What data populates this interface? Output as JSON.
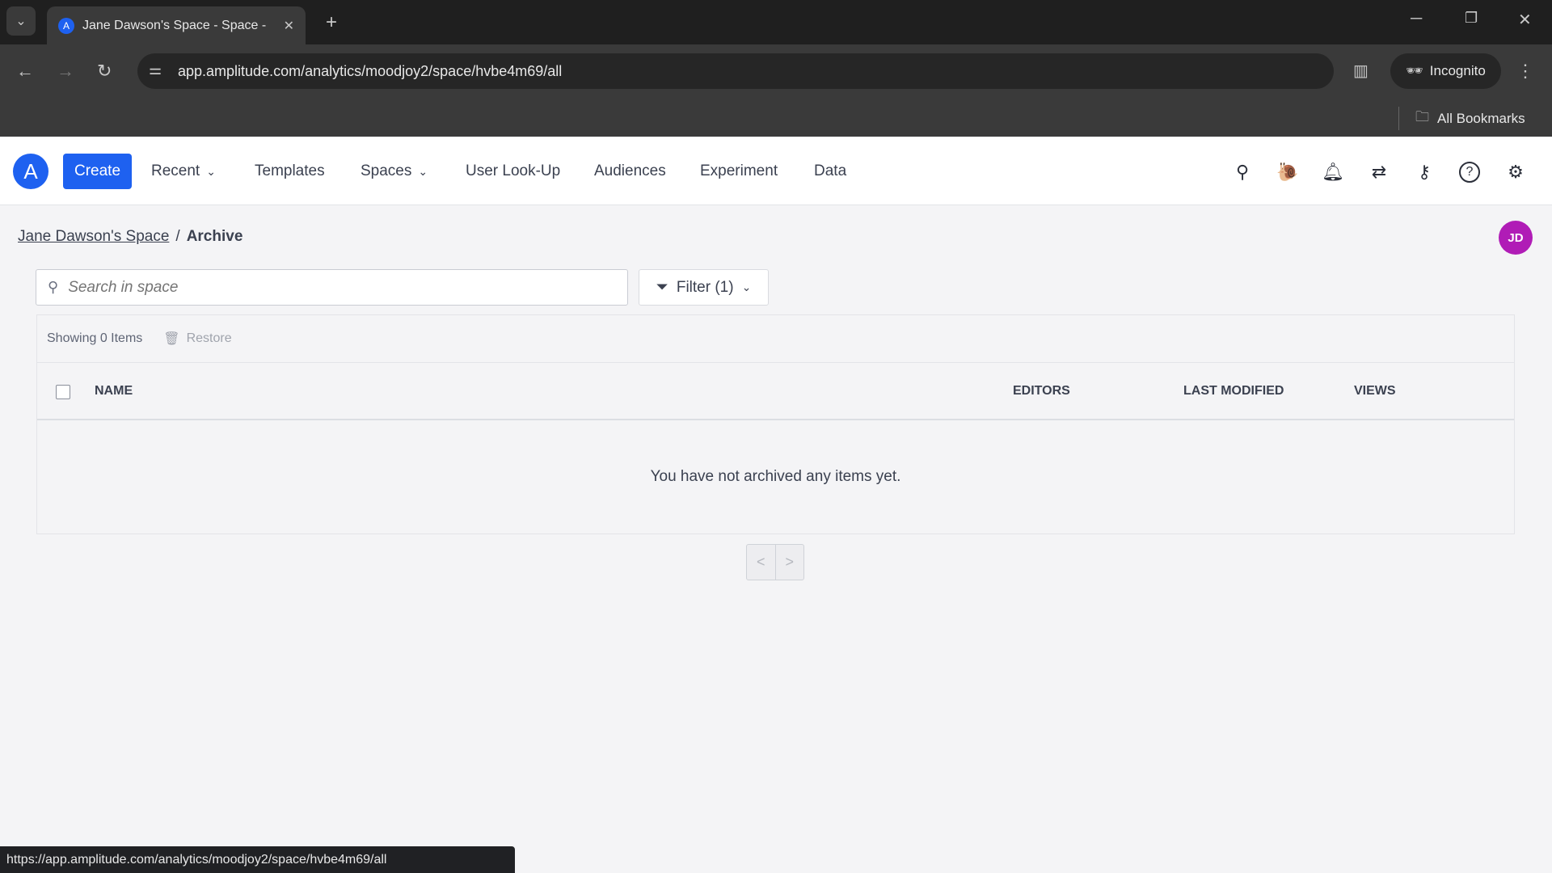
{
  "browser": {
    "tab_title": "Jane Dawson's Space - Space -",
    "url": "app.amplitude.com/analytics/moodjoy2/space/hvbe4m69/all",
    "incognito": "Incognito",
    "bookmarks": "All Bookmarks",
    "status_url": "https://app.amplitude.com/analytics/moodjoy2/space/hvbe4m69/all"
  },
  "nav": {
    "create": "Create",
    "items": [
      "Recent",
      "Templates",
      "Spaces",
      "User Look-Up",
      "Audiences",
      "Experiment",
      "Data"
    ],
    "icons": [
      "search-icon",
      "snail-icon",
      "bell-icon",
      "sync-arrows-icon",
      "key-sparkle-icon",
      "help-icon",
      "gear-icon"
    ]
  },
  "breadcrumb": {
    "parent": "Jane Dawson's Space",
    "sep": "/",
    "current": "Archive"
  },
  "avatar": {
    "initials": "JD",
    "color": "#b01cb6"
  },
  "search": {
    "placeholder": "Search in space"
  },
  "filter": {
    "label": "Filter (1)"
  },
  "table": {
    "showing": "Showing 0 Items",
    "restore": "Restore",
    "columns": [
      "NAME",
      "EDITORS",
      "LAST MODIFIED",
      "VIEWS"
    ],
    "empty": "You have not archived any items yet."
  },
  "pager": {
    "prev": "<",
    "next": ">"
  },
  "colors": {
    "accent": "#1e61f0"
  }
}
